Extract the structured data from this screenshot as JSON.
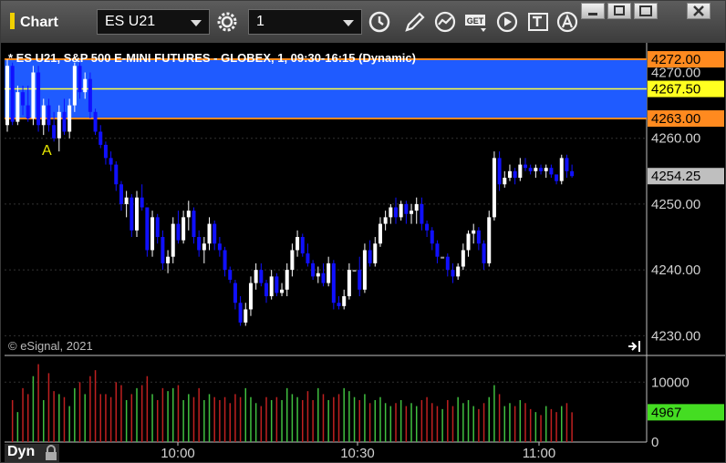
{
  "window": {
    "title": "Chart"
  },
  "toolbar": {
    "symbol": "ES U21",
    "interval": "1",
    "get_label": "GET"
  },
  "chart": {
    "title": "* ES U21, S&P 500 E-MINI FUTURES - GLOBEX, 1, 09:30-16:15 (Dynamic)",
    "watermark": "© eSignal, 2021",
    "annotation": "A",
    "volume_label": "Dyn"
  },
  "colors": {
    "background": "#000000",
    "up": "#ffffff",
    "down": "#1010ff",
    "neutral": "#9a9a9a",
    "zone": "#1f5bff",
    "zone_border": "#ff8a1f",
    "mid_line": "#ffff40",
    "vol_up": "#40c040",
    "vol_down": "#c02020"
  },
  "chart_data": {
    "type": "candlestick",
    "price_axis": {
      "ticks": [
        "4270.00",
        "4260.00",
        "4250.00",
        "4240.00",
        "4230.00"
      ],
      "ylim": [
        4227,
        4274.5
      ]
    },
    "volume_axis": {
      "ticks": [
        "10000",
        "0"
      ],
      "ylim": [
        0,
        14000
      ]
    },
    "time_axis": {
      "ticks": [
        "10:00",
        "10:30",
        "11:00"
      ]
    },
    "zone": {
      "high": 4272.0,
      "low": 4263.0,
      "mid": 4267.5
    },
    "price_labels": [
      {
        "value": "4272.00",
        "level": 4272.0,
        "kind": "zone"
      },
      {
        "value": "4267.50",
        "level": 4267.5,
        "kind": "mid"
      },
      {
        "value": "4263.00",
        "level": 4263.0,
        "kind": "zone"
      },
      {
        "value": "4254.25",
        "level": 4254.25,
        "kind": "last"
      }
    ],
    "volume_last": {
      "value": "4967",
      "level": 4967
    },
    "candles": [
      [
        4262.0,
        4272.0,
        4261.0,
        4271.0,
        1
      ],
      [
        4271.0,
        4271.5,
        4262.0,
        4262.5,
        7000
      ],
      [
        4262.5,
        4268.0,
        4262.0,
        4267.0,
        5000
      ],
      [
        4267.0,
        4268.0,
        4263.5,
        4265.0,
        9000
      ],
      [
        4265.0,
        4268.0,
        4262.5,
        4263.0,
        8000
      ],
      [
        4263.0,
        4271.0,
        4262.0,
        4270.0,
        11000
      ],
      [
        4270.0,
        4271.0,
        4261.0,
        4262.0,
        13000
      ],
      [
        4262.0,
        4266.0,
        4260.5,
        4265.0,
        7000
      ],
      [
        4265.0,
        4266.0,
        4261.0,
        4262.0,
        11500
      ],
      [
        4262.0,
        4264.0,
        4259.5,
        4260.0,
        8500
      ],
      [
        4260.0,
        4265.0,
        4258.0,
        4264.0,
        8000
      ],
      [
        4264.0,
        4266.0,
        4260.5,
        4261.0,
        7500
      ],
      [
        4261.0,
        4266.0,
        4260.0,
        4265.0,
        6000
      ],
      [
        4265.0,
        4271.5,
        4264.0,
        4271.0,
        9000
      ],
      [
        4271.0,
        4271.5,
        4266.0,
        4267.0,
        10000
      ],
      [
        4267.0,
        4270.0,
        4266.0,
        4269.0,
        8000
      ],
      [
        4269.0,
        4270.0,
        4263.0,
        4264.0,
        11000
      ],
      [
        4264.0,
        4264.5,
        4260.5,
        4261.0,
        12000
      ],
      [
        4261.0,
        4262.0,
        4258.5,
        4259.0,
        8000
      ],
      [
        4259.0,
        4259.5,
        4256.0,
        4257.0,
        8000
      ],
      [
        4257.0,
        4258.0,
        4255.0,
        4256.0,
        7500
      ],
      [
        4256.0,
        4256.5,
        4252.0,
        4253.0,
        10000
      ],
      [
        4253.0,
        4253.5,
        4249.0,
        4250.0,
        9500
      ],
      [
        4250.0,
        4252.0,
        4248.0,
        4251.0,
        7000
      ],
      [
        4251.0,
        4251.5,
        4245.0,
        4246.0,
        8000
      ],
      [
        4246.0,
        4252.0,
        4245.0,
        4251.0,
        9000
      ],
      [
        4251.0,
        4253.0,
        4249.0,
        4249.5,
        9500
      ],
      [
        4249.5,
        4249.5,
        4242.0,
        4243.0,
        11000
      ],
      [
        4243.0,
        4249.0,
        4242.0,
        4248.0,
        8000
      ],
      [
        4248.0,
        4248.5,
        4244.0,
        4245.0,
        7000
      ],
      [
        4245.0,
        4246.0,
        4240.0,
        4241.0,
        9000
      ],
      [
        4241.0,
        4243.0,
        4239.5,
        4242.0,
        8500
      ],
      [
        4242.0,
        4248.0,
        4241.0,
        4247.0,
        9000
      ],
      [
        4247.0,
        4249.0,
        4244.0,
        4244.5,
        9500
      ],
      [
        4244.5,
        4249.0,
        4244.0,
        4248.0,
        7000
      ],
      [
        4248.0,
        4250.5,
        4246.0,
        4249.0,
        8000
      ],
      [
        4249.0,
        4249.5,
        4244.0,
        4245.0,
        7500
      ],
      [
        4245.0,
        4246.0,
        4242.0,
        4243.0,
        9000
      ],
      [
        4243.0,
        4245.0,
        4241.0,
        4244.0,
        7000
      ],
      [
        4244.0,
        4248.0,
        4243.0,
        4247.0,
        8000
      ],
      [
        4247.0,
        4247.5,
        4243.0,
        4244.0,
        7500
      ],
      [
        4244.0,
        4245.0,
        4242.0,
        4243.0,
        7000
      ],
      [
        4243.0,
        4243.5,
        4239.0,
        4240.0,
        7500
      ],
      [
        4240.0,
        4240.5,
        4238.0,
        4238.5,
        6500
      ],
      [
        4238.0,
        4238.5,
        4234.0,
        4235.0,
        8000
      ],
      [
        4235.0,
        4236.0,
        4231.5,
        4232.0,
        7500
      ],
      [
        4232.0,
        4235.0,
        4231.5,
        4234.0,
        9000
      ],
      [
        4234.0,
        4239.0,
        4233.0,
        4238.0,
        7500
      ],
      [
        4238.0,
        4241.0,
        4237.0,
        4240.0,
        6500
      ],
      [
        4240.0,
        4241.0,
        4237.5,
        4238.0,
        6000
      ],
      [
        4238.0,
        4238.5,
        4235.0,
        4236.0,
        7500
      ],
      [
        4236.0,
        4240.0,
        4235.5,
        4239.0,
        7000
      ],
      [
        4239.0,
        4239.5,
        4236.0,
        4236.5,
        7500
      ],
      [
        4236.5,
        4238.0,
        4236.0,
        4237.0,
        7000
      ],
      [
        4237.0,
        4241.0,
        4236.0,
        4240.0,
        9000
      ],
      [
        4240.0,
        4244.0,
        4239.0,
        4243.0,
        8000
      ],
      [
        4243.0,
        4246.0,
        4242.0,
        4245.0,
        7500
      ],
      [
        4245.0,
        4245.5,
        4242.0,
        4242.5,
        7000
      ],
      [
        4242.5,
        4244.0,
        4240.5,
        4241.0,
        8500
      ],
      [
        4241.0,
        4241.5,
        4238.5,
        4239.0,
        7000
      ],
      [
        4239.0,
        4240.5,
        4238.0,
        4239.5,
        9000
      ],
      [
        4239.5,
        4241.0,
        4237.5,
        4238.0,
        8000
      ],
      [
        4238.0,
        4242.0,
        4237.5,
        4241.0,
        7000
      ],
      [
        4241.0,
        4241.5,
        4234.0,
        4235.0,
        7500
      ],
      [
        4235.0,
        4236.0,
        4234.0,
        4234.5,
        8000
      ],
      [
        4234.5,
        4237.0,
        4234.0,
        4236.0,
        9000
      ],
      [
        4236.0,
        4241.0,
        4235.5,
        4240.0,
        8500
      ],
      [
        4240.0,
        4240.0,
        4240.0,
        4240.0,
        7500
      ],
      [
        4240.0,
        4242.0,
        4236.0,
        4237.0,
        7000
      ],
      [
        4237.0,
        4244.0,
        4236.5,
        4243.0,
        8000
      ],
      [
        4243.0,
        4244.5,
        4240.5,
        4241.0,
        6500
      ],
      [
        4241.0,
        4245.0,
        4240.5,
        4244.0,
        7000
      ],
      [
        4244.0,
        4248.0,
        4243.5,
        4247.0,
        7500
      ],
      [
        4247.0,
        4249.0,
        4246.0,
        4248.0,
        6500
      ],
      [
        4248.0,
        4250.0,
        4247.0,
        4249.5,
        6000
      ],
      [
        4249.5,
        4251.0,
        4247.0,
        4248.0,
        6500
      ],
      [
        4248.0,
        4250.5,
        4247.5,
        4250.0,
        7000
      ],
      [
        4250.0,
        4250.5,
        4247.0,
        4248.5,
        6000
      ],
      [
        4248.5,
        4250.0,
        4247.0,
        4249.0,
        6500
      ],
      [
        4249.0,
        4251.0,
        4247.0,
        4250.0,
        6000
      ],
      [
        4250.0,
        4251.0,
        4246.0,
        4247.0,
        7000
      ],
      [
        4247.0,
        4247.5,
        4245.0,
        4246.0,
        7500
      ],
      [
        4246.0,
        4246.5,
        4243.0,
        4244.0,
        6500
      ],
      [
        4244.0,
        4244.5,
        4241.0,
        4242.0,
        6000
      ],
      [
        4242.0,
        4242.0,
        4242.0,
        4242.0,
        5500
      ],
      [
        4242.0,
        4242.5,
        4239.0,
        4240.0,
        7000
      ],
      [
        4240.0,
        4241.0,
        4238.0,
        4239.0,
        6000
      ],
      [
        4239.0,
        4241.0,
        4238.5,
        4240.5,
        7500
      ],
      [
        4240.5,
        4244.0,
        4240.0,
        4243.0,
        6500
      ],
      [
        4243.0,
        4246.0,
        4242.0,
        4245.5,
        7000
      ],
      [
        4245.5,
        4247.0,
        4244.0,
        4246.0,
        6000
      ],
      [
        4246.0,
        4246.5,
        4243.0,
        4244.0,
        5500
      ],
      [
        4244.0,
        4244.5,
        4240.0,
        4241.0,
        6500
      ],
      [
        4241.0,
        4249.0,
        4240.5,
        4248.0,
        7500
      ],
      [
        4248.0,
        4258.0,
        4247.5,
        4257.0,
        9500
      ],
      [
        4257.0,
        4258.0,
        4252.0,
        4253.0,
        8000
      ],
      [
        4253.0,
        4255.0,
        4252.5,
        4254.0,
        6000
      ],
      [
        4254.0,
        4256.0,
        4253.5,
        4255.0,
        6500
      ],
      [
        4255.0,
        4255.5,
        4253.0,
        4254.0,
        6000
      ],
      [
        4254.0,
        4257.0,
        4253.5,
        4256.0,
        7000
      ],
      [
        4256.0,
        4257.0,
        4255.0,
        4255.5,
        6500
      ],
      [
        4255.5,
        4256.0,
        4254.5,
        4255.0,
        5500
      ],
      [
        4255.0,
        4256.0,
        4254.0,
        4255.5,
        5000
      ],
      [
        4255.5,
        4256.0,
        4254.5,
        4255.0,
        4500
      ],
      [
        4255.0,
        4256.0,
        4254.0,
        4255.5,
        6000
      ],
      [
        4255.5,
        4256.0,
        4254.0,
        4254.5,
        5500
      ],
      [
        4254.5,
        4254.5,
        4253.0,
        4253.5,
        5000
      ],
      [
        4253.5,
        4257.5,
        4253.0,
        4257.0,
        6000
      ],
      [
        4257.0,
        4257.5,
        4254.0,
        4255.0,
        6500
      ],
      [
        4255.0,
        4256.0,
        4254.0,
        4254.25,
        4967
      ]
    ]
  }
}
